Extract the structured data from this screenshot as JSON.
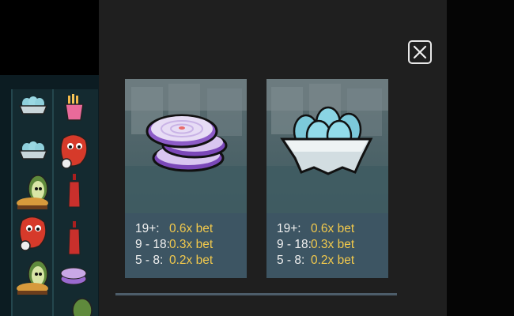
{
  "close_icon": "close-icon",
  "cards": [
    {
      "symbol_icon": "red-onion-slices-icon",
      "paytable": [
        {
          "range": "19+:",
          "value": "0.6x bet"
        },
        {
          "range": "9 - 18:",
          "value": "0.3x bet"
        },
        {
          "range": "5 - 8:",
          "value": "0.2x bet"
        }
      ]
    },
    {
      "symbol_icon": "egg-carton-icon",
      "paytable": [
        {
          "range": "19+:",
          "value": "0.6x bet"
        },
        {
          "range": "9 - 18:",
          "value": "0.3x bet"
        },
        {
          "range": "5 - 8:",
          "value": "0.2x bet"
        }
      ]
    }
  ],
  "colors": {
    "value": "#f2c94c",
    "range": "#f0f0f0",
    "panel": "#1f1f1f",
    "pay_bg": "#3d5563"
  }
}
